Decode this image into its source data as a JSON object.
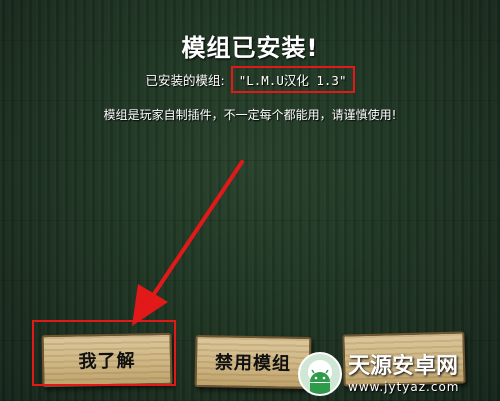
{
  "dialog": {
    "title": "模组已安装!",
    "installed_label": "已安装的模组:",
    "installed_mod": "\"L.M.U汉化 1.3\"",
    "warning": "模组是玩家自制插件，不一定每个都能用，请谨慎使用!"
  },
  "buttons": {
    "ok_label": "我了解",
    "disable_label": "禁用模组",
    "third_label": ""
  },
  "watermark": {
    "title": "天源安卓网",
    "url": "www.jytyaz.com"
  },
  "colors": {
    "annotation_red": "#e11919",
    "wood": "#d6bf8e",
    "background": "#1f3323"
  },
  "icons": {
    "arrow": "red-arrow-icon",
    "watermark_logo": "android-logo-icon"
  }
}
